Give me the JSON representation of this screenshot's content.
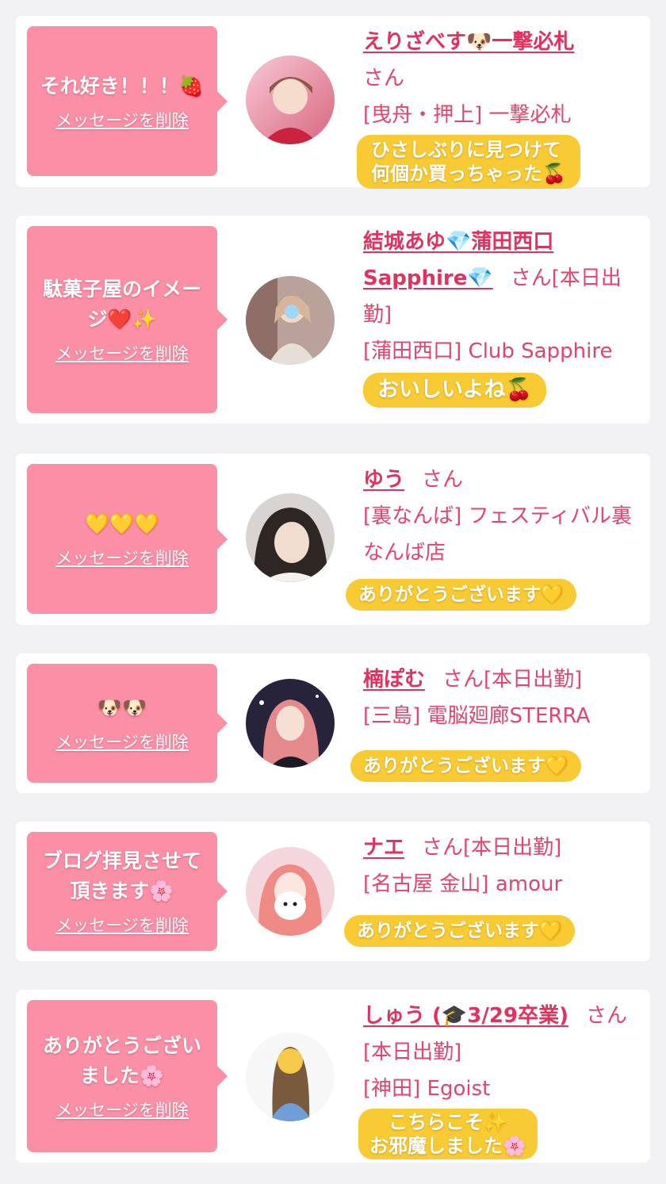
{
  "delete_label": "メッセージを削除",
  "san": "さん",
  "colors": {
    "bubble": "#fb8fa6",
    "reply": "#f8ca33",
    "name": "#e3315e",
    "background": "#f2f2f4"
  },
  "messages": [
    {
      "message": "それ好き！！！🍓",
      "name": "えりざべす🐶一撃必札",
      "status": "",
      "shop": "[曳舟・押上] 一撃必札",
      "reply": [
        "ひさしぶりに見つけて",
        "何個か買っちゃった🍒"
      ]
    },
    {
      "message": "駄菓子屋のイメージ❤️✨",
      "name": "結城あゆ💎蒲田西口Sapphire💎",
      "status": "[本日出勤]",
      "shop": "[蒲田西口] Club Sapphire",
      "reply": [
        "おいしいよね🍒"
      ]
    },
    {
      "message": "💛💛💛",
      "name": "ゆう",
      "status": "",
      "shop": "[裏なんば] フェスティバル裏なんば店",
      "reply": [
        "ありがとうございます💛"
      ]
    },
    {
      "message": "🐶🐶",
      "name": "楠ぽむ",
      "status": "[本日出勤]",
      "shop": "[三島] 電脳廻廊STERRA",
      "reply": [
        "ありがとうございます💛"
      ]
    },
    {
      "message": "ブログ拝見させて頂きます🌸",
      "name": "ナエ",
      "status": "[本日出勤]",
      "shop": "[名古屋 金山] amour",
      "reply": [
        "ありがとうございます💛"
      ]
    },
    {
      "message": "ありがとうございました🌸",
      "name": "しゅう (🎓3/29卒業)",
      "status": "[本日出勤]",
      "shop": "[神田] Egoist",
      "reply": [
        "こちらこそ✨",
        "お邪魔しました🌸"
      ]
    }
  ]
}
